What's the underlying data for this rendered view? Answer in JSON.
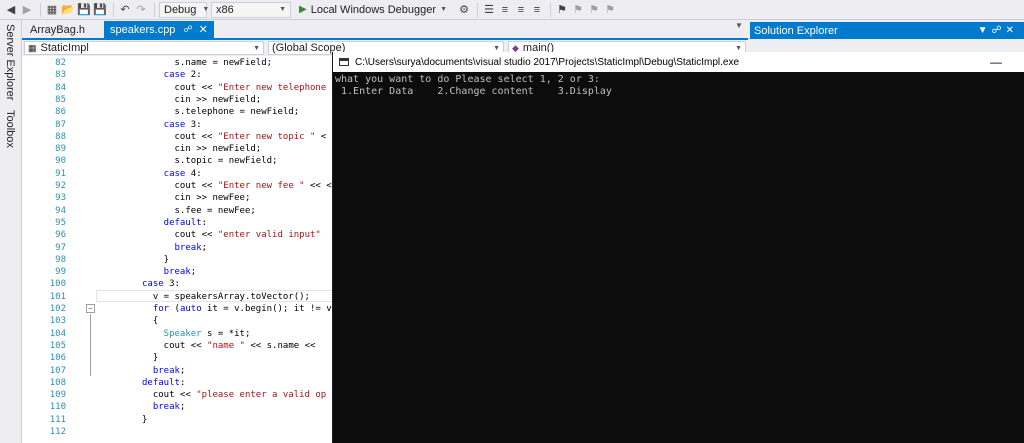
{
  "toolbar": {
    "config": "Debug",
    "platform": "x86",
    "run_label": "Local Windows Debugger"
  },
  "left_rail": {
    "server_explorer": "Server Explorer",
    "toolbox": "Toolbox"
  },
  "tabs": [
    {
      "label": "ArrayBag.h",
      "active": false
    },
    {
      "label": "speakers.cpp",
      "active": true
    }
  ],
  "nav_bar": {
    "project": "StaticImpl",
    "scope": "(Global Scope)",
    "member": "main()"
  },
  "editor": {
    "line_numbers": [
      "82",
      "83",
      "84",
      "85",
      "86",
      "87",
      "88",
      "89",
      "90",
      "91",
      "92",
      "93",
      "94",
      "95",
      "96",
      "97",
      "98",
      "99",
      "100",
      "101",
      "102",
      "103",
      "104",
      "105",
      "106",
      "107",
      "108",
      "109",
      "110",
      "111",
      "112"
    ],
    "lines": [
      "s.name = newField;",
      "case 2:",
      "cout << \"Enter new telephone",
      "cin >> newField;",
      "s.telephone = newField;",
      "case 3:",
      "cout << \"Enter new topic \" <",
      "cin >> newField;",
      "s.topic = newField;",
      "case 4:",
      "cout << \"Enter new fee \" << <",
      "cin >> newFee;",
      "s.fee = newFee;",
      "default:",
      "cout << \"enter valid input\"",
      "break;",
      "}",
      "break;",
      "case 3:",
      "v = speakersArray.toVector();",
      "for (auto it = v.begin(); it != v",
      "{",
      "Speaker s = *it;",
      "cout << \"name \" << s.name <<",
      "}",
      "break;",
      "default:",
      "cout << \"please enter a valid op",
      "break;",
      "}",
      ""
    ]
  },
  "console": {
    "title": "C:\\Users\\surya\\documents\\visual studio 2017\\Projects\\StaticImpl\\Debug\\StaticImpl.exe",
    "line1": "what you want to do Please select 1, 2 or 3:",
    "line2": " 1.Enter Data    2.Change content    3.Display"
  },
  "solution_explorer": {
    "title": "Solution Explorer"
  },
  "colors": {
    "accent": "#007acc",
    "console_bg": "#0c0c0c",
    "console_text": "#c0c0c0",
    "keyword": "#0000ff",
    "string": "#a31515",
    "line_number": "#2b91af"
  }
}
